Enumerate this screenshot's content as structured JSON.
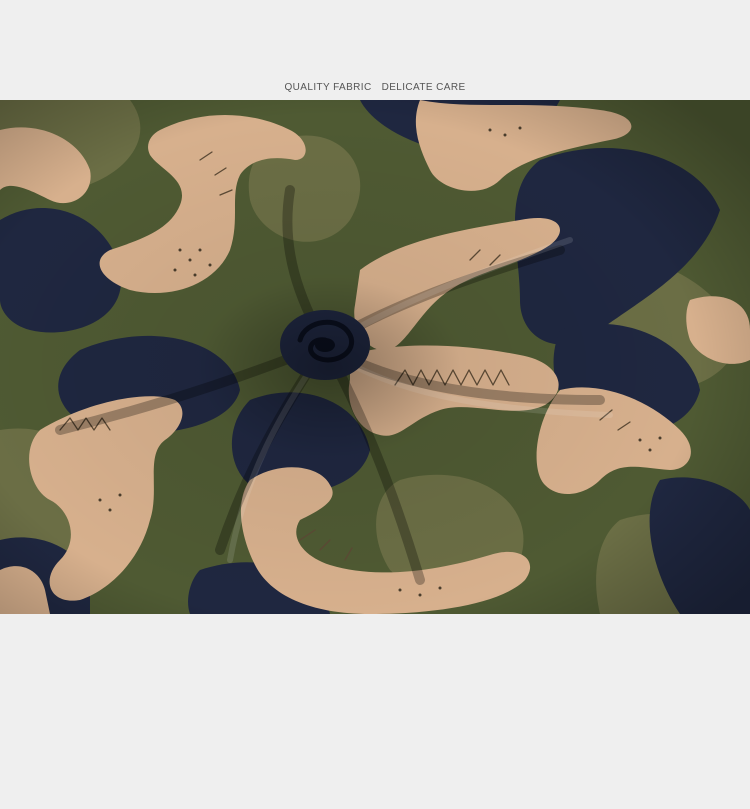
{
  "caption": {
    "part1": "QUALITY FABRIC",
    "part2": "DELICATE CARE"
  },
  "colors": {
    "background": "#efefef",
    "fabric_olive": "#4f5a33",
    "fabric_khaki": "#6b6e45",
    "fabric_navy": "#1f2740",
    "fabric_tan": "#d7b08d",
    "caption_text": "#555555"
  },
  "image": {
    "subject": "camouflage-dinosaur-print-fabric-swirl"
  }
}
